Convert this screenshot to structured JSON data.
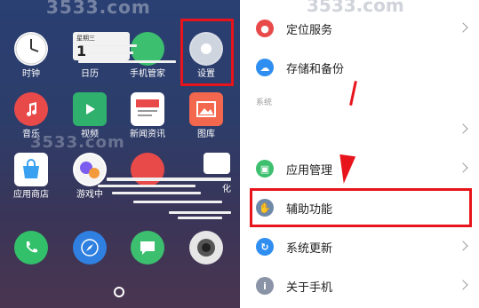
{
  "watermark": "3533.com",
  "home": {
    "apps": [
      {
        "label": "时钟",
        "icon": "clock-icon",
        "color": "#ffffff"
      },
      {
        "label": "日历",
        "icon": "calendar-icon",
        "color": "#ffffff"
      },
      {
        "label": "手机管家",
        "icon": "phone-manager-icon",
        "color": "#3cbf6e"
      },
      {
        "label": "设置",
        "icon": "gear-icon",
        "color": "#d8dde6"
      },
      {
        "label": "音乐",
        "icon": "music-icon",
        "color": "#e84a4a"
      },
      {
        "label": "视频",
        "icon": "video-icon",
        "color": "#2fb06c"
      },
      {
        "label": "新闻资讯",
        "icon": "news-icon",
        "color": "#ffffff"
      },
      {
        "label": "图库",
        "icon": "gallery-icon",
        "color": "#f2674d"
      },
      {
        "label": "应用商店",
        "icon": "app-store-icon",
        "color": "#ffffff"
      },
      {
        "label": "游戏中",
        "icon": "game-center-icon",
        "color": "#ffffff"
      },
      {
        "label": "化",
        "icon": "theme-icon",
        "color": "#ffffff"
      },
      {
        "label": "",
        "icon": "phone-icon",
        "color": "#33c06a"
      },
      {
        "label": "",
        "icon": "browser-icon",
        "color": "#2f80e0"
      },
      {
        "label": "",
        "icon": "messages-icon",
        "color": "#3cbf6e"
      },
      {
        "label": "",
        "icon": "camera-icon",
        "color": "#e6e6e6"
      }
    ],
    "date_widget": {
      "weekday": "星期三",
      "day": "1"
    }
  },
  "settings": {
    "section_label": "系统",
    "rows": [
      {
        "label": "定位服务",
        "icon": "location-icon",
        "color": "#e84a4a",
        "glyph": "●"
      },
      {
        "label": "存储和备份",
        "icon": "cloud-icon",
        "color": "#2f8ef0",
        "glyph": "☁"
      },
      {
        "label": "",
        "icon": "",
        "color": "",
        "glyph": ""
      },
      {
        "label": "应用管理",
        "icon": "android-icon",
        "color": "#3cbf6e",
        "glyph": "▣"
      },
      {
        "label": "辅助功能",
        "icon": "hand-icon",
        "color": "#6f8aa8",
        "glyph": "✋"
      },
      {
        "label": "系统更新",
        "icon": "update-icon",
        "color": "#2f8ef0",
        "glyph": "↻"
      },
      {
        "label": "关于手机",
        "icon": "info-icon",
        "color": "#8a94a6",
        "glyph": "i"
      }
    ]
  }
}
